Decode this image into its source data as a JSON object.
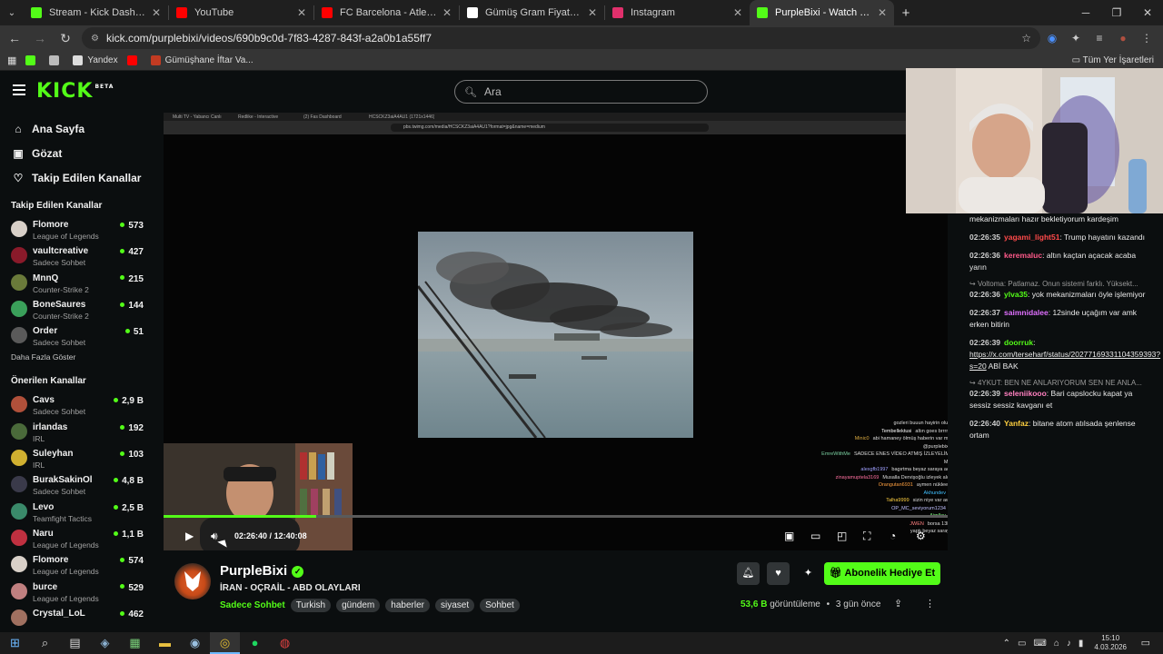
{
  "browser": {
    "tabs": [
      {
        "title": "Stream - Kick Dashboard",
        "color": "#53fc18",
        "active": false
      },
      {
        "title": "YouTube",
        "color": "#ff0000",
        "active": false
      },
      {
        "title": "FC Barcelona - Atletico Madrid",
        "color": "#ff0000",
        "active": false
      },
      {
        "title": "Gümüş Gram Fiyatı Canlı - Bug",
        "color": "#ffffff",
        "active": false
      },
      {
        "title": "Instagram",
        "color": "#e1306c",
        "active": false
      },
      {
        "title": "PurpleBixi - Watch the VOD",
        "color": "#53fc18",
        "active": true
      }
    ],
    "new_tab": "+",
    "url": "kick.com/purplebixi/videos/690b9c0d-7f83-4287-843f-a2a0b1a55ff7",
    "bookmarks": [
      {
        "label": "",
        "color": "#53fc18"
      },
      {
        "label": "",
        "color": "#bbbbbb"
      },
      {
        "label": "Yandex",
        "color": "#dddddd"
      },
      {
        "label": "",
        "color": "#ff0000"
      },
      {
        "label": "Gümüşhane İftar Va...",
        "color": "#c23b22"
      }
    ],
    "all_bookmarks": "Tüm Yer İşaretleri"
  },
  "kick": {
    "logo": "KICK",
    "logo_badge": "BETA",
    "search_placeholder": "Ara",
    "nav": [
      {
        "label": "Ana Sayfa",
        "icon": "home-icon",
        "glyph": "⌂"
      },
      {
        "label": "Gözat",
        "icon": "browse-icon",
        "glyph": "▣"
      },
      {
        "label": "Takip Edilen Kanallar",
        "icon": "heart-icon",
        "glyph": "♡"
      }
    ],
    "followed_title": "Takip Edilen Kanallar",
    "followed": [
      {
        "name": "Flomore",
        "category": "League of Legends",
        "viewers": "573",
        "color": "#d8d0c8"
      },
      {
        "name": "vaultcreative",
        "category": "Sadece Sohbet",
        "viewers": "427",
        "color": "#8a1a2a"
      },
      {
        "name": "MnnQ",
        "category": "Counter-Strike 2",
        "viewers": "215",
        "color": "#6a7a3a"
      },
      {
        "name": "BoneSaures",
        "category": "Counter-Strike 2",
        "viewers": "144",
        "color": "#3aa05a"
      },
      {
        "name": "Order",
        "category": "Sadece Sohbet",
        "viewers": "51",
        "color": "#5a5a5a"
      }
    ],
    "show_more": "Daha Fazla Göster",
    "recommended_title": "Önerilen Kanallar",
    "recommended": [
      {
        "name": "Cavs",
        "category": "Sadece Sohbet",
        "viewers": "2,9 B",
        "color": "#b0503a"
      },
      {
        "name": "irlandas",
        "category": "IRL",
        "viewers": "192",
        "color": "#4a6a3a"
      },
      {
        "name": "Suleyhan",
        "category": "IRL",
        "viewers": "103",
        "color": "#d0b030"
      },
      {
        "name": "BurakSakinOl",
        "category": "Sadece Sohbet",
        "viewers": "4,8 B",
        "color": "#3a3a4a"
      },
      {
        "name": "Levo",
        "category": "Teamfight Tactics",
        "viewers": "2,5 B",
        "color": "#3a8a6a"
      },
      {
        "name": "Naru",
        "category": "League of Legends",
        "viewers": "1,1 B",
        "color": "#c03040"
      },
      {
        "name": "Flomore",
        "category": "League of Legends",
        "viewers": "574",
        "color": "#d8d0c8"
      },
      {
        "name": "burce",
        "category": "League of Legends",
        "viewers": "529",
        "color": "#c08080"
      },
      {
        "name": "Crystal_LoL",
        "category": "",
        "viewers": "462",
        "color": "#a07060"
      }
    ]
  },
  "player": {
    "inner_tabs": [
      "Multi TV - Yabancı Canlı",
      "Redlike - Interactive",
      "(2) Fas Dashboard",
      "HCSCKZ3aiA4AU1 (1721x1446)"
    ],
    "inner_url": "pbs.twimg.com/media/HCSCKZ3aiA4AU1?format=jpg&name=medium",
    "overlay_chat": [
      {
        "user": "",
        "text": "gozleri buuun hayirin olur",
        "color": "#e8e8e8"
      },
      {
        "user": "Tembellektusi",
        "text": "altın goes brrrrr",
        "color": "#ffffff"
      },
      {
        "user": "Minic0",
        "text": "abi hamaney ölmüş haberin var mı",
        "color": "#d8a840"
      },
      {
        "user": "",
        "text": "@purplebixi",
        "color": "#e8e8e8"
      },
      {
        "user": "EmreWithMe",
        "text": "SADECE ENES VİDEO ATMIŞ İZLEYELİM",
        "color": "#7ad0a0"
      },
      {
        "user": "",
        "text": "Mİ",
        "color": "#e8e8e8"
      },
      {
        "user": "alexgfb1997",
        "text": "bagırtma beyaz saraya aq",
        "color": "#a0a0ff"
      },
      {
        "user": "zinayamuptela3169",
        "text": "Musalla Dervişoğlu izleyek alo",
        "color": "#ff70a0"
      },
      {
        "user": "Orangutan6931",
        "text": "aymen nükleer",
        "color": "#ffa040"
      },
      {
        "user": "Akhundev",
        "text": "",
        "color": "#40c0ff"
      },
      {
        "user": "Talha9999",
        "text": "sizin niye var aw",
        "color": "#ffd040"
      },
      {
        "user": "OP_MC_seviyorum1234",
        "text": "",
        "color": "#c0c0ff"
      },
      {
        "user": "Aimlley",
        "text": "",
        "color": "#80ff80"
      },
      {
        "user": "JWEN",
        "text": "borsa 13k",
        "color": "#ff8080"
      },
      {
        "user": "",
        "text": "yaptı beyaz saray",
        "color": "#e8e8e8"
      }
    ],
    "time_current": "02:26:40",
    "time_sep": "/",
    "time_total": "12:40:08",
    "progress": 0.195
  },
  "chat": [
    {
      "reply": "",
      "time": "",
      "user": "",
      "user_color": "#ffffff",
      "text": "mekanizmaları hazır bekletiyorum kardeşim",
      "link": ""
    },
    {
      "reply": "",
      "time": "02:26:35",
      "user": "yagami_light51",
      "user_color": "#ff4a4a",
      "text": "Trump hayatını kazandı",
      "link": ""
    },
    {
      "reply": "",
      "time": "02:26:36",
      "user": "keremaluc",
      "user_color": "#ff5a8a",
      "text": "altın kaçtan açacak acaba yarın",
      "link": ""
    },
    {
      "reply": "Voltoma: Patlamaz. Onun sistemi farklı. Yüksekt...",
      "time": "02:26:36",
      "user": "ylva35",
      "user_color": "#53fc18",
      "text": "yok mekanizmaları öyle işlemiyor",
      "link": ""
    },
    {
      "reply": "",
      "time": "02:26:37",
      "user": "saimnidalee",
      "user_color": "#e070ff",
      "text": "12sinde uçağım var amk erken bitirin",
      "link": ""
    },
    {
      "reply": "",
      "time": "02:26:39",
      "user": "doorruk",
      "user_color": "#53fc18",
      "text": "ABİ BAK",
      "link": "https://x.com/terseharf/status/20277169331104359393?s=20"
    },
    {
      "reply": "4YKUT: BEN NE ANLARIYORUM SEN NE ANLA...",
      "time": "02:26:39",
      "user": "seleniikooo",
      "user_color": "#ff80c0",
      "text": "Bari capslocku kapat ya sessiz sessiz kavganı et",
      "link": ""
    },
    {
      "reply": "",
      "time": "02:26:40",
      "user": "Yanfaz",
      "user_color": "#ffd040",
      "text": "bitane atom atılsada şenlense ortam",
      "link": ""
    }
  ],
  "stream": {
    "name": "PurpleBixi",
    "title": "İRAN - OÇRAİL - ABD OLAYLARI",
    "category": "Sadece Sohbet",
    "tags": [
      "Turkish",
      "gündem",
      "haberler",
      "siyaset",
      "Sohbet"
    ],
    "subscribe_label": "Abonelik Hediye Et",
    "views_count": "53,6 B",
    "views_label": "görüntüleme",
    "dot": "•",
    "ago": "3 gün önce"
  },
  "taskbar": {
    "clock_time": "15:10",
    "clock_date": "4.03.2026"
  }
}
